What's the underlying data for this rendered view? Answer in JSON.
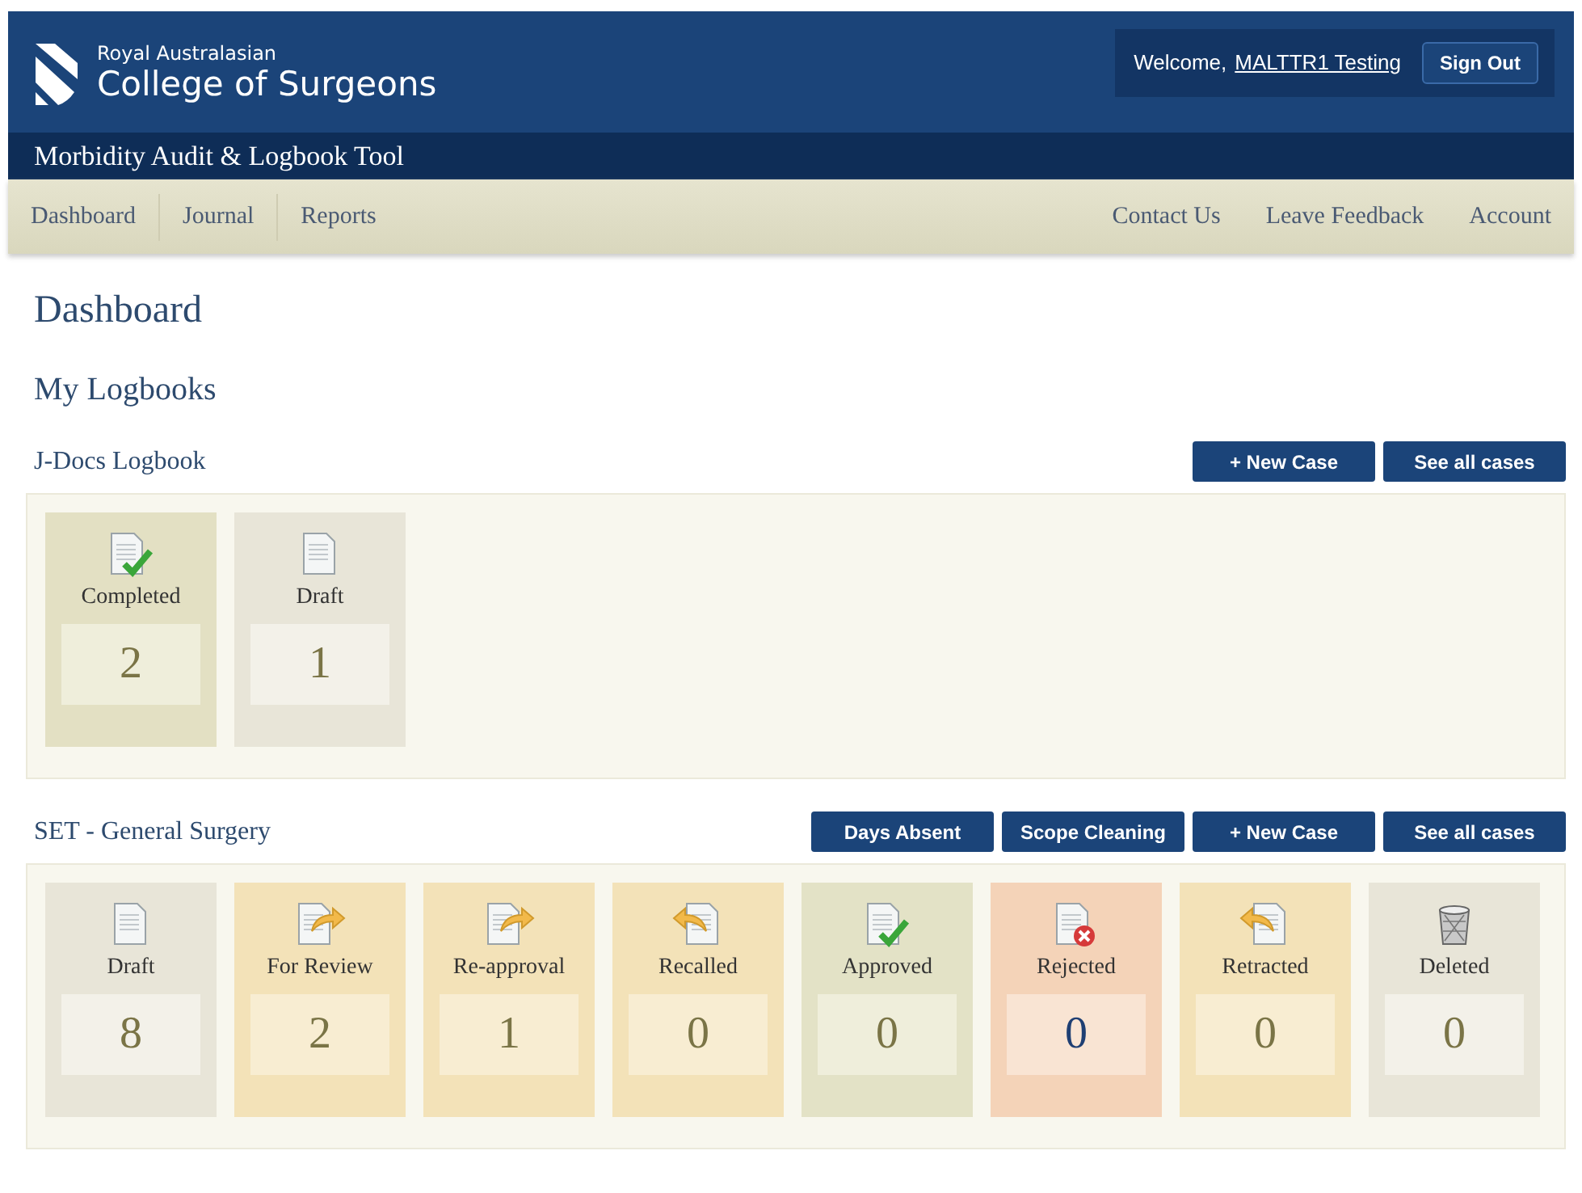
{
  "header": {
    "org_line1": "Royal Australasian",
    "org_line2": "College of Surgeons",
    "welcome": "Welcome,",
    "user": "MALTTR1 Testing",
    "sign_out": "Sign Out"
  },
  "app_title": "Morbidity Audit & Logbook Tool",
  "nav_left": [
    "Dashboard",
    "Journal",
    "Reports"
  ],
  "nav_right": [
    "Contact Us",
    "Leave Feedback",
    "Account"
  ],
  "page_title": "Dashboard",
  "section_title": "My Logbooks",
  "logbooks": [
    {
      "title": "J-Docs Logbook",
      "buttons": [
        "+ New Case",
        "See all cases"
      ],
      "tiles": [
        {
          "kind": "completed",
          "label": "Completed",
          "count": "2"
        },
        {
          "kind": "draft",
          "label": "Draft",
          "count": "1"
        }
      ]
    },
    {
      "title": "SET - General Surgery",
      "buttons": [
        "Days Absent",
        "Scope Cleaning",
        "+ New Case",
        "See all cases"
      ],
      "tiles": [
        {
          "kind": "draft",
          "label": "Draft",
          "count": "8"
        },
        {
          "kind": "review",
          "label": "For Review",
          "count": "2"
        },
        {
          "kind": "review",
          "label": "Re-approval",
          "count": "1"
        },
        {
          "kind": "recalled",
          "label": "Recalled",
          "count": "0"
        },
        {
          "kind": "approved",
          "label": "Approved",
          "count": "0"
        },
        {
          "kind": "rejected",
          "label": "Rejected",
          "count": "0"
        },
        {
          "kind": "recalled",
          "label": "Retracted",
          "count": "0"
        },
        {
          "kind": "deleted",
          "label": "Deleted",
          "count": "0"
        }
      ]
    }
  ]
}
